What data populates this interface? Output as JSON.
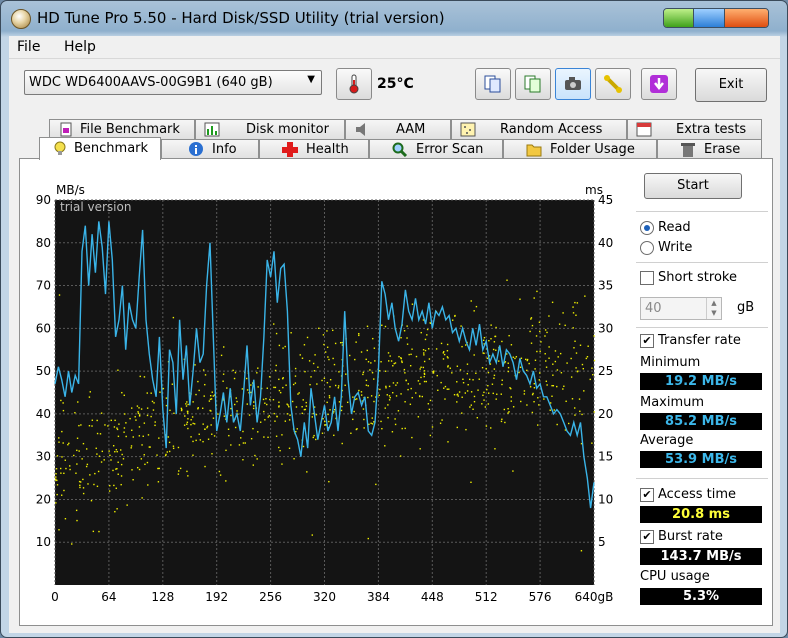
{
  "window": {
    "title": "HD Tune Pro 5.50 - Hard Disk/SSD Utility (trial version)"
  },
  "menu": {
    "file": "File",
    "help": "Help"
  },
  "toolbar": {
    "disk": "WDC WD6400AAVS-00G9B1 (640 gB)",
    "temperature": "25°C",
    "exit": "Exit"
  },
  "tabs_top": [
    "File Benchmark",
    "Disk monitor",
    "AAM",
    "Random Access",
    "Extra tests"
  ],
  "tabs_bottom": [
    "Benchmark",
    "Info",
    "Health",
    "Error Scan",
    "Folder Usage",
    "Erase"
  ],
  "active_tab": "Benchmark",
  "controls": {
    "start": "Start",
    "read": "Read",
    "write": "Write",
    "mode_selected": "read",
    "short_stroke": "Short stroke",
    "short_stroke_checked": false,
    "stroke_value": "40",
    "stroke_unit": "gB",
    "transfer_rate": "Transfer rate",
    "transfer_rate_checked": true,
    "minimum_label": "Minimum",
    "minimum_value": "19.2 MB/s",
    "maximum_label": "Maximum",
    "maximum_value": "85.2 MB/s",
    "average_label": "Average",
    "average_value": "53.9 MB/s",
    "access_time": "Access time",
    "access_time_checked": true,
    "access_time_value": "20.8 ms",
    "burst_rate": "Burst rate",
    "burst_rate_checked": true,
    "burst_rate_value": "143.7 MB/s",
    "cpu_usage": "CPU usage",
    "cpu_usage_value": "5.3%"
  },
  "colors": {
    "transfer_line": "#3ab4e8",
    "access_dots": "#f0f000",
    "plot_bg": "#141414",
    "grid": "#5a5a5a"
  },
  "chart_data": {
    "type": "line",
    "watermark": "trial version",
    "ylabel": "MB/s",
    "y2label": "ms",
    "xunit": "gB",
    "xlim": [
      0,
      640
    ],
    "ylim": [
      0,
      90
    ],
    "y2lim": [
      0,
      45
    ],
    "xticks": [
      "0",
      "64",
      "128",
      "192",
      "256",
      "320",
      "384",
      "448",
      "512",
      "576",
      "640gB"
    ],
    "yticks": [
      "10",
      "20",
      "30",
      "40",
      "50",
      "60",
      "70",
      "80",
      "90"
    ],
    "y2ticks": [
      "5",
      "10",
      "15",
      "20",
      "25",
      "30",
      "35",
      "40",
      "45"
    ],
    "grid": true,
    "series": [
      {
        "name": "Transfer rate",
        "axis": "left",
        "x": [
          0,
          4,
          8,
          12,
          16,
          20,
          24,
          28,
          32,
          36,
          40,
          44,
          48,
          52,
          56,
          60,
          64,
          68,
          72,
          76,
          80,
          84,
          88,
          92,
          96,
          100,
          104,
          108,
          112,
          116,
          120,
          124,
          128,
          132,
          136,
          140,
          144,
          148,
          152,
          156,
          160,
          164,
          168,
          172,
          176,
          180,
          184,
          188,
          192,
          196,
          200,
          204,
          208,
          212,
          216,
          220,
          224,
          228,
          232,
          236,
          240,
          244,
          248,
          252,
          256,
          260,
          264,
          268,
          272,
          276,
          280,
          284,
          288,
          292,
          296,
          300,
          304,
          308,
          312,
          316,
          320,
          324,
          328,
          332,
          336,
          340,
          344,
          348,
          352,
          356,
          360,
          364,
          368,
          372,
          376,
          380,
          384,
          388,
          392,
          396,
          400,
          404,
          408,
          412,
          416,
          420,
          424,
          428,
          432,
          436,
          440,
          444,
          448,
          452,
          456,
          460,
          464,
          468,
          472,
          476,
          480,
          484,
          488,
          492,
          496,
          500,
          504,
          508,
          512,
          516,
          520,
          524,
          528,
          532,
          536,
          540,
          544,
          548,
          552,
          556,
          560,
          564,
          568,
          572,
          576,
          580,
          584,
          588,
          592,
          596,
          600,
          604,
          608,
          612,
          616,
          620,
          624,
          628,
          632,
          636,
          640
        ],
        "values": [
          47,
          51,
          48,
          44,
          50,
          45,
          49,
          47,
          78,
          84,
          70,
          82,
          73,
          85,
          79,
          68,
          85,
          76,
          58,
          62,
          70,
          55,
          66,
          62,
          60,
          72,
          83,
          62,
          54,
          48,
          44,
          58,
          41,
          32,
          55,
          52,
          40,
          62,
          48,
          56,
          42,
          50,
          60,
          52,
          54,
          70,
          80,
          58,
          36,
          40,
          45,
          38,
          46,
          38,
          40,
          36,
          45,
          56,
          42,
          48,
          38,
          44,
          58,
          76,
          72,
          78,
          66,
          74,
          75,
          64,
          42,
          36,
          34,
          30,
          38,
          32,
          46,
          40,
          34,
          38,
          42,
          36,
          38,
          44,
          36,
          44,
          64,
          48,
          40,
          44,
          45,
          42,
          44,
          36,
          35,
          38,
          50,
          71,
          68,
          62,
          66,
          60,
          57,
          61,
          69,
          64,
          62,
          67,
          62,
          64,
          61,
          66,
          60,
          64,
          63,
          65,
          62,
          63,
          59,
          60,
          57,
          60,
          57,
          55,
          60,
          56,
          61,
          55,
          57,
          52,
          54,
          52,
          56,
          51,
          55,
          54,
          52,
          48,
          53,
          50,
          49,
          47,
          50,
          46,
          47,
          44,
          44,
          42,
          40,
          41,
          40,
          38,
          36,
          35,
          38,
          35,
          38,
          30,
          25,
          18,
          24
        ]
      },
      {
        "name": "Access time",
        "axis": "right",
        "style": "scatter",
        "spread_ms": [
          2,
          36
        ],
        "trend_ms": [
          [
            0,
            13
          ],
          [
            64,
            16
          ],
          [
            128,
            18
          ],
          [
            192,
            20
          ],
          [
            256,
            21
          ],
          [
            320,
            23
          ],
          [
            384,
            24
          ],
          [
            448,
            25
          ],
          [
            512,
            25
          ],
          [
            576,
            25
          ],
          [
            640,
            25
          ]
        ]
      }
    ]
  }
}
